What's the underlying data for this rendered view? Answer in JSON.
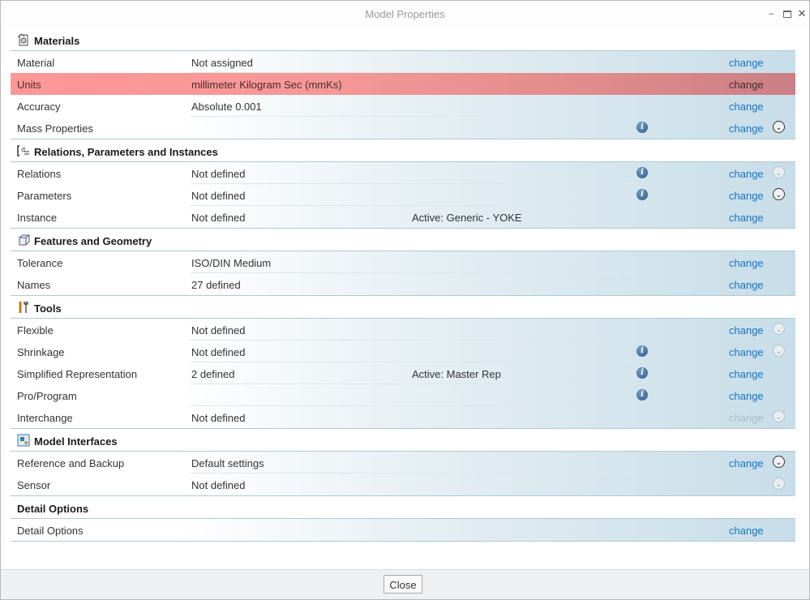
{
  "window": {
    "title": "Model Properties"
  },
  "sections": {
    "materials": {
      "title": "Materials",
      "rows": [
        {
          "name": "Material",
          "value": "Not assigned",
          "action": "change"
        },
        {
          "name": "Units",
          "value": "millimeter Kilogram Sec (mmKs)",
          "action": "change"
        },
        {
          "name": "Accuracy",
          "value": "Absolute 0.001",
          "action": "change"
        },
        {
          "name": "Mass Properties",
          "value": "",
          "action": "change"
        }
      ]
    },
    "relations": {
      "title": "Relations, Parameters and Instances",
      "rows": [
        {
          "name": "Relations",
          "value": "Not defined",
          "action": "change"
        },
        {
          "name": "Parameters",
          "value": "Not defined",
          "action": "change"
        },
        {
          "name": "Instance",
          "value": "Not defined",
          "active": "Active: Generic - YOKE",
          "action": "change"
        }
      ]
    },
    "features": {
      "title": "Features and Geometry",
      "rows": [
        {
          "name": "Tolerance",
          "value": "ISO/DIN Medium",
          "action": "change"
        },
        {
          "name": "Names",
          "value": "27 defined",
          "action": "change"
        }
      ]
    },
    "tools": {
      "title": "Tools",
      "rows": [
        {
          "name": "Flexible",
          "value": "Not defined",
          "action": "change"
        },
        {
          "name": "Shrinkage",
          "value": "Not defined",
          "action": "change"
        },
        {
          "name": "Simplified Representation",
          "value": "2 defined",
          "active": "Active: Master Rep",
          "action": "change"
        },
        {
          "name": "Pro/Program",
          "value": "",
          "action": "change"
        },
        {
          "name": "Interchange",
          "value": "Not defined",
          "action": "change"
        }
      ]
    },
    "interfaces": {
      "title": "Model Interfaces",
      "rows": [
        {
          "name": "Reference and Backup",
          "value": "Default settings",
          "action": "change"
        },
        {
          "name": "Sensor",
          "value": "Not defined"
        }
      ]
    },
    "detail": {
      "title": "Detail Options",
      "rows": [
        {
          "name": "Detail Options",
          "value": "",
          "action": "change"
        }
      ]
    }
  },
  "footer": {
    "close_label": "Close"
  },
  "colors": {
    "highlight": "#ff9797",
    "link": "#1a73c2",
    "accent": "#c7dde8"
  }
}
